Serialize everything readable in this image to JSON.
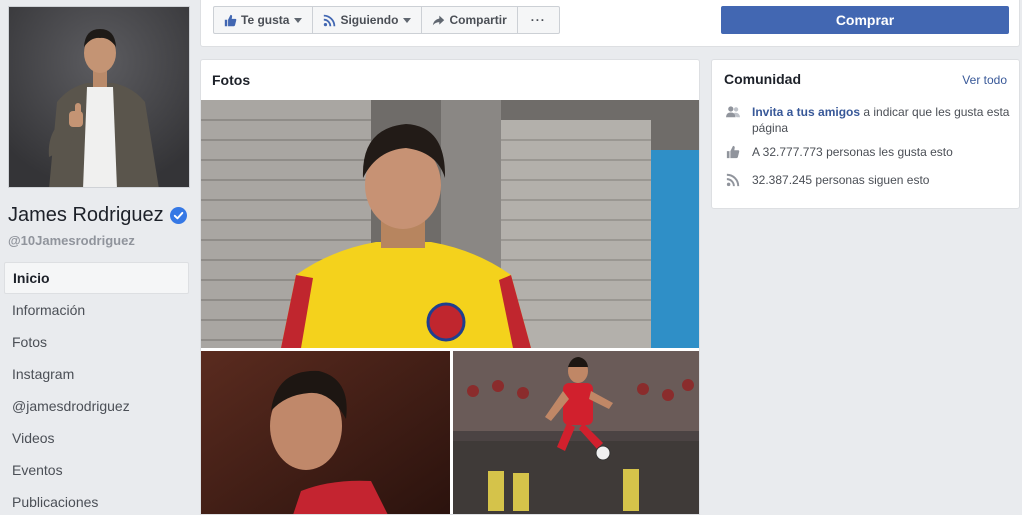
{
  "profile": {
    "name": "James Rodriguez",
    "username": "@10Jamesrodriguez"
  },
  "nav": {
    "items": [
      {
        "label": "Inicio",
        "active": true
      },
      {
        "label": "Información"
      },
      {
        "label": "Fotos"
      },
      {
        "label": "Instagram"
      },
      {
        "label": "@jamesdrodriguez"
      },
      {
        "label": "Videos"
      },
      {
        "label": "Eventos"
      },
      {
        "label": "Publicaciones"
      }
    ]
  },
  "actions": {
    "like_label": "Te gusta",
    "following_label": "Siguiendo",
    "share_label": "Compartir",
    "more_label": "···",
    "buy_label": "Comprar"
  },
  "photos": {
    "title": "Fotos"
  },
  "community": {
    "title": "Comunidad",
    "see_all": "Ver todo",
    "invite_link": "Invita a tus amigos",
    "invite_rest": " a indicar que les gusta esta página",
    "likes_text": "A 32.777.773 personas les gusta esto",
    "followers_text": "32.387.245 personas siguen esto"
  },
  "colors": {
    "brand_blue": "#4267b2",
    "link_blue": "#385898",
    "verified_blue": "#3578e5",
    "background": "#e9ebee"
  },
  "icons": {
    "like": "thumbs-up-icon",
    "follow": "rss-icon",
    "share": "share-arrow-icon",
    "more": "ellipsis-icon",
    "verified": "verified-badge-icon",
    "invite": "friends-icon",
    "likes": "thumbs-up-icon",
    "followers": "rss-icon"
  }
}
